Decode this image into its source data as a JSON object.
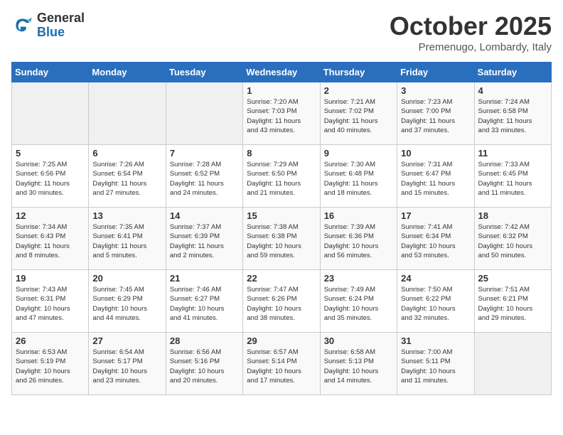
{
  "logo": {
    "general": "General",
    "blue": "Blue"
  },
  "header": {
    "month": "October 2025",
    "location": "Premenugo, Lombardy, Italy"
  },
  "weekdays": [
    "Sunday",
    "Monday",
    "Tuesday",
    "Wednesday",
    "Thursday",
    "Friday",
    "Saturday"
  ],
  "weeks": [
    [
      {
        "day": "",
        "info": ""
      },
      {
        "day": "",
        "info": ""
      },
      {
        "day": "",
        "info": ""
      },
      {
        "day": "1",
        "info": "Sunrise: 7:20 AM\nSunset: 7:03 PM\nDaylight: 11 hours\nand 43 minutes."
      },
      {
        "day": "2",
        "info": "Sunrise: 7:21 AM\nSunset: 7:02 PM\nDaylight: 11 hours\nand 40 minutes."
      },
      {
        "day": "3",
        "info": "Sunrise: 7:23 AM\nSunset: 7:00 PM\nDaylight: 11 hours\nand 37 minutes."
      },
      {
        "day": "4",
        "info": "Sunrise: 7:24 AM\nSunset: 6:58 PM\nDaylight: 11 hours\nand 33 minutes."
      }
    ],
    [
      {
        "day": "5",
        "info": "Sunrise: 7:25 AM\nSunset: 6:56 PM\nDaylight: 11 hours\nand 30 minutes."
      },
      {
        "day": "6",
        "info": "Sunrise: 7:26 AM\nSunset: 6:54 PM\nDaylight: 11 hours\nand 27 minutes."
      },
      {
        "day": "7",
        "info": "Sunrise: 7:28 AM\nSunset: 6:52 PM\nDaylight: 11 hours\nand 24 minutes."
      },
      {
        "day": "8",
        "info": "Sunrise: 7:29 AM\nSunset: 6:50 PM\nDaylight: 11 hours\nand 21 minutes."
      },
      {
        "day": "9",
        "info": "Sunrise: 7:30 AM\nSunset: 6:48 PM\nDaylight: 11 hours\nand 18 minutes."
      },
      {
        "day": "10",
        "info": "Sunrise: 7:31 AM\nSunset: 6:47 PM\nDaylight: 11 hours\nand 15 minutes."
      },
      {
        "day": "11",
        "info": "Sunrise: 7:33 AM\nSunset: 6:45 PM\nDaylight: 11 hours\nand 11 minutes."
      }
    ],
    [
      {
        "day": "12",
        "info": "Sunrise: 7:34 AM\nSunset: 6:43 PM\nDaylight: 11 hours\nand 8 minutes."
      },
      {
        "day": "13",
        "info": "Sunrise: 7:35 AM\nSunset: 6:41 PM\nDaylight: 11 hours\nand 5 minutes."
      },
      {
        "day": "14",
        "info": "Sunrise: 7:37 AM\nSunset: 6:39 PM\nDaylight: 11 hours\nand 2 minutes."
      },
      {
        "day": "15",
        "info": "Sunrise: 7:38 AM\nSunset: 6:38 PM\nDaylight: 10 hours\nand 59 minutes."
      },
      {
        "day": "16",
        "info": "Sunrise: 7:39 AM\nSunset: 6:36 PM\nDaylight: 10 hours\nand 56 minutes."
      },
      {
        "day": "17",
        "info": "Sunrise: 7:41 AM\nSunset: 6:34 PM\nDaylight: 10 hours\nand 53 minutes."
      },
      {
        "day": "18",
        "info": "Sunrise: 7:42 AM\nSunset: 6:32 PM\nDaylight: 10 hours\nand 50 minutes."
      }
    ],
    [
      {
        "day": "19",
        "info": "Sunrise: 7:43 AM\nSunset: 6:31 PM\nDaylight: 10 hours\nand 47 minutes."
      },
      {
        "day": "20",
        "info": "Sunrise: 7:45 AM\nSunset: 6:29 PM\nDaylight: 10 hours\nand 44 minutes."
      },
      {
        "day": "21",
        "info": "Sunrise: 7:46 AM\nSunset: 6:27 PM\nDaylight: 10 hours\nand 41 minutes."
      },
      {
        "day": "22",
        "info": "Sunrise: 7:47 AM\nSunset: 6:26 PM\nDaylight: 10 hours\nand 38 minutes."
      },
      {
        "day": "23",
        "info": "Sunrise: 7:49 AM\nSunset: 6:24 PM\nDaylight: 10 hours\nand 35 minutes."
      },
      {
        "day": "24",
        "info": "Sunrise: 7:50 AM\nSunset: 6:22 PM\nDaylight: 10 hours\nand 32 minutes."
      },
      {
        "day": "25",
        "info": "Sunrise: 7:51 AM\nSunset: 6:21 PM\nDaylight: 10 hours\nand 29 minutes."
      }
    ],
    [
      {
        "day": "26",
        "info": "Sunrise: 6:53 AM\nSunset: 5:19 PM\nDaylight: 10 hours\nand 26 minutes."
      },
      {
        "day": "27",
        "info": "Sunrise: 6:54 AM\nSunset: 5:17 PM\nDaylight: 10 hours\nand 23 minutes."
      },
      {
        "day": "28",
        "info": "Sunrise: 6:56 AM\nSunset: 5:16 PM\nDaylight: 10 hours\nand 20 minutes."
      },
      {
        "day": "29",
        "info": "Sunrise: 6:57 AM\nSunset: 5:14 PM\nDaylight: 10 hours\nand 17 minutes."
      },
      {
        "day": "30",
        "info": "Sunrise: 6:58 AM\nSunset: 5:13 PM\nDaylight: 10 hours\nand 14 minutes."
      },
      {
        "day": "31",
        "info": "Sunrise: 7:00 AM\nSunset: 5:11 PM\nDaylight: 10 hours\nand 11 minutes."
      },
      {
        "day": "",
        "info": ""
      }
    ]
  ]
}
